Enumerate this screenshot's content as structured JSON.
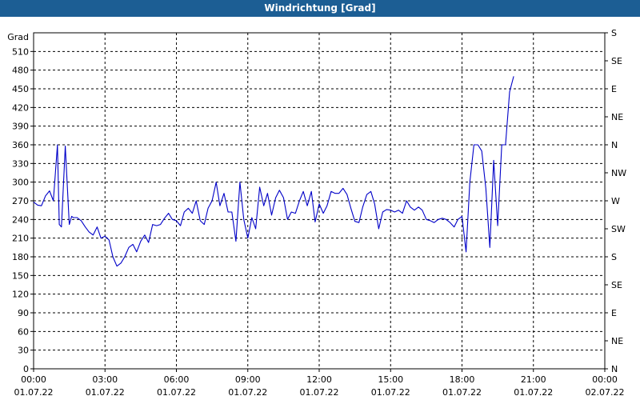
{
  "window": {
    "title": "Windrichtung [Grad]"
  },
  "chart_data": {
    "type": "line",
    "title": "Windrichtung [Grad]",
    "ylabel": "Grad",
    "ylim": [
      0,
      540
    ],
    "yticks": [
      0,
      30,
      60,
      90,
      120,
      150,
      180,
      210,
      240,
      270,
      300,
      330,
      360,
      390,
      420,
      450,
      480,
      510
    ],
    "right_axis_labels": [
      "N",
      "NE",
      "E",
      "SE",
      "S",
      "SW",
      "W",
      "NW",
      "N",
      "NE",
      "E",
      "SE",
      "S"
    ],
    "x_ticks": [
      {
        "time": "00:00",
        "date": "01.07.22"
      },
      {
        "time": "03:00",
        "date": "01.07.22"
      },
      {
        "time": "06:00",
        "date": "01.07.22"
      },
      {
        "time": "09:00",
        "date": "01.07.22"
      },
      {
        "time": "12:00",
        "date": "01.07.22"
      },
      {
        "time": "15:00",
        "date": "01.07.22"
      },
      {
        "time": "18:00",
        "date": "01.07.22"
      },
      {
        "time": "21:00",
        "date": "01.07.22"
      },
      {
        "time": "00:00",
        "date": "02.07.22"
      }
    ],
    "xlim_hours": [
      0,
      24
    ],
    "line_color": "#0000c8",
    "grid": "dashed",
    "series": [
      {
        "hours": [
          0.0,
          0.17,
          0.33,
          0.5,
          0.67,
          0.83,
          1.0,
          1.08,
          1.17,
          1.33,
          1.5,
          1.6,
          1.67,
          1.83,
          2.0,
          2.17,
          2.33,
          2.5,
          2.67,
          2.83,
          3.0,
          3.17,
          3.33,
          3.5,
          3.67,
          3.83,
          4.0,
          4.17,
          4.33,
          4.5,
          4.67,
          4.83,
          5.0,
          5.17,
          5.33,
          5.5,
          5.67,
          5.83,
          6.0,
          6.17,
          6.33,
          6.5,
          6.67,
          6.83,
          7.0,
          7.17,
          7.33,
          7.5,
          7.67,
          7.83,
          8.0,
          8.17,
          8.33,
          8.5,
          8.67,
          8.83,
          9.0,
          9.17,
          9.33,
          9.5,
          9.67,
          9.83,
          10.0,
          10.17,
          10.33,
          10.5,
          10.67,
          10.83,
          11.0,
          11.17,
          11.33,
          11.5,
          11.67,
          11.83,
          12.0,
          12.17,
          12.33,
          12.5,
          12.67,
          12.83,
          13.0,
          13.17,
          13.33,
          13.5,
          13.67,
          13.83,
          14.0,
          14.17,
          14.33,
          14.5,
          14.67,
          14.83,
          15.0,
          15.17,
          15.33,
          15.5,
          15.67,
          15.83,
          16.0,
          16.17,
          16.33,
          16.5,
          16.67,
          16.83,
          17.0,
          17.17,
          17.33,
          17.5,
          17.67,
          17.83,
          18.0,
          18.17,
          18.33,
          18.5,
          18.67,
          18.83,
          19.0,
          19.17,
          19.33,
          19.5,
          19.67,
          19.83,
          20.0,
          20.17,
          20.33,
          20.5,
          20.67,
          20.83,
          21.0,
          21.17,
          21.33,
          21.5,
          21.67,
          21.83,
          22.0,
          22.17,
          22.33,
          22.5,
          22.67,
          22.83,
          23.0,
          23.17,
          23.33,
          23.5,
          23.67,
          23.83,
          24.0
        ],
        "values": [
          268,
          263,
          262,
          278,
          286,
          270,
          360,
          232,
          228,
          358,
          232,
          245,
          243,
          243,
          238,
          228,
          220,
          215,
          228,
          210,
          213,
          207,
          180,
          165,
          170,
          180,
          195,
          200,
          188,
          205,
          215,
          203,
          232,
          230,
          232,
          242,
          250,
          240,
          238,
          230,
          252,
          258,
          250,
          270,
          238,
          232,
          258,
          270,
          300,
          262,
          282,
          252,
          252,
          205,
          300,
          240,
          210,
          243,
          225,
          292,
          262,
          282,
          247,
          275,
          287,
          275,
          240,
          252,
          250,
          270,
          285,
          262,
          285,
          236,
          265,
          250,
          262,
          285,
          282,
          282,
          290,
          280,
          258,
          237,
          235,
          260,
          280,
          285,
          265,
          225,
          252,
          256,
          255,
          252,
          255,
          250,
          270,
          260,
          255,
          260,
          255,
          240,
          238,
          235,
          240,
          242,
          240,
          235,
          228,
          240,
          245,
          188,
          300,
          360,
          360,
          350,
          290,
          195,
          335,
          230,
          360,
          360,
          445,
          470
        ]
      }
    ]
  }
}
